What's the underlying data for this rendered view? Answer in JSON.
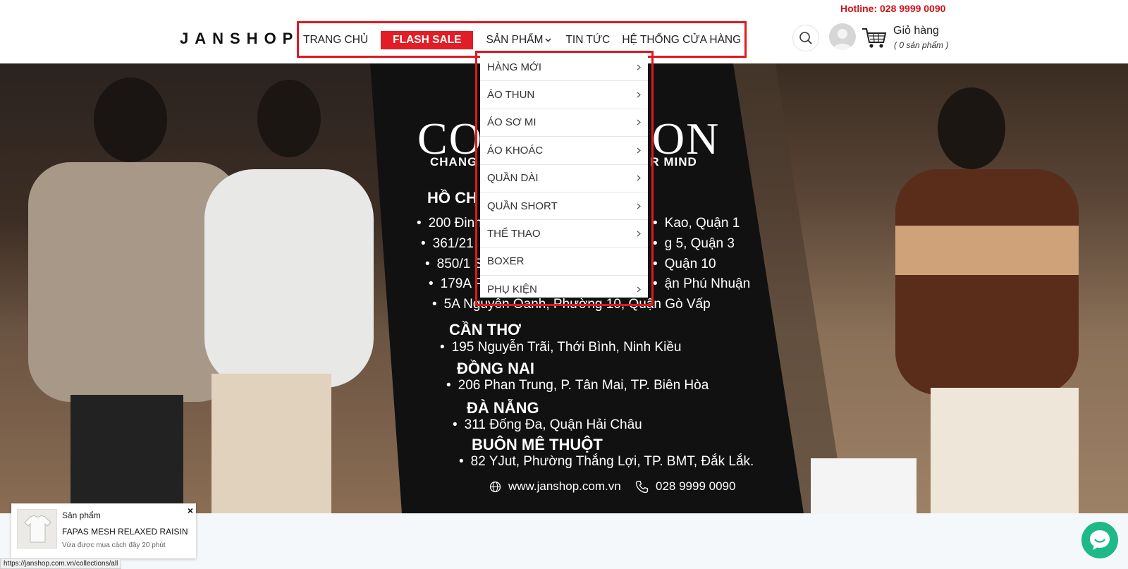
{
  "header": {
    "hotline": "Hotline: 028 9999 0090",
    "logo": "JANSHOP",
    "nav": {
      "home": "TRANG CHỦ",
      "flash_sale": "FLASH SALE",
      "products": "SẢN PHẨM",
      "news": "TIN TỨC",
      "stores": "HỆ THỐNG CỬA HÀNG"
    },
    "cart": {
      "title": "Giỏ hàng",
      "count": "( 0 sản phẩm )"
    }
  },
  "products_menu": [
    {
      "label": "HÀNG MỚI",
      "has_sub": true
    },
    {
      "label": "ÁO THUN",
      "has_sub": true
    },
    {
      "label": "ÁO SƠ MI",
      "has_sub": true
    },
    {
      "label": "ÁO KHOÁC",
      "has_sub": true
    },
    {
      "label": "QUẦN DÀI",
      "has_sub": true
    },
    {
      "label": "QUẦN SHORT",
      "has_sub": true
    },
    {
      "label": "THỂ THAO",
      "has_sub": true
    },
    {
      "label": "BOXER",
      "has_sub": false
    },
    {
      "label": "PHỤ KIỆN",
      "has_sub": true
    }
  ],
  "banner": {
    "headline_left": "CO",
    "headline_right": "ON",
    "tagline_left": "CHANG",
    "tagline_right": "R MIND",
    "hcm_title": "HỒ CH",
    "hcm_addresses": [
      {
        "left": "200 Đinh",
        "right": "Kao, Quận 1"
      },
      {
        "left": "361/21",
        "right": "g 5, Quận 3"
      },
      {
        "left": "850/1 S",
        "right": "Quận 10"
      },
      {
        "left": "179A P",
        "right": "ận Phú Nhuận"
      },
      {
        "left": "5A Nguyễn Oanh, Phường 10, Quận Gò Vấp",
        "right": ""
      }
    ],
    "cantho_title": "CẦN THƠ",
    "cantho_addr": "195 Nguyễn Trãi, Thới Bình, Ninh Kiều",
    "dongnai_title": "ĐỒNG NAI",
    "dongnai_addr": "206 Phan Trung, P. Tân Mai, TP. Biên Hòa",
    "danang_title": "ĐÀ NẴNG",
    "danang_addr": "311 Đống Đa, Quận Hải Châu",
    "bmt_title": "BUÔN MÊ THUỘT",
    "bmt_addr": "82 YJut, Phường Thắng Lợi, TP. BMT, Đắk Lắk.",
    "website": "www.janshop.com.vn",
    "phone": "028 9999 0090"
  },
  "toast": {
    "label": "Sản phẩm",
    "product_name": "FAPAS MESH RELAXED RAISIN",
    "time": "Vừa được mua cách đây 20 phút",
    "close": "×"
  },
  "status_url": "https://janshop.com.vn/collections/all",
  "colors": {
    "brand_red": "#e21d25",
    "chat_green": "#1eb989"
  }
}
